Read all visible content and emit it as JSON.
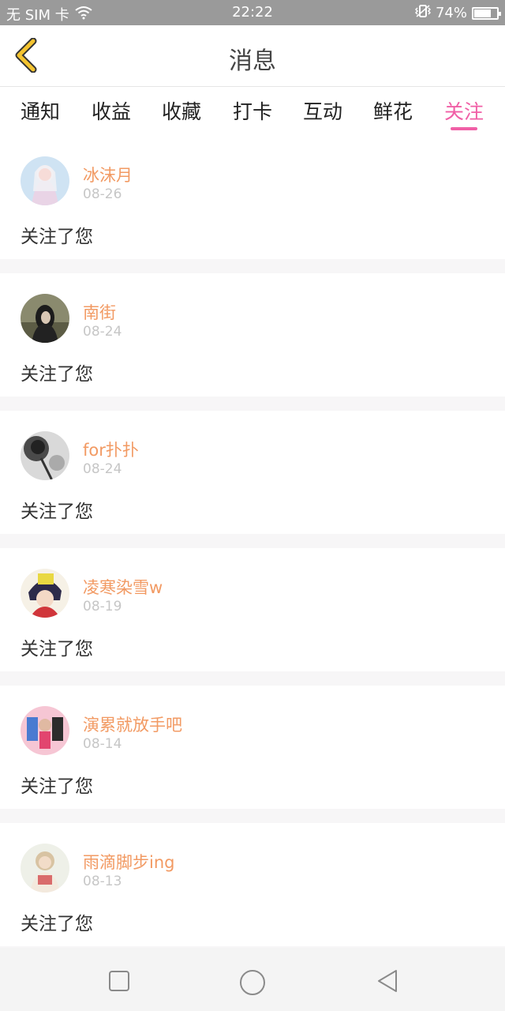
{
  "status_bar": {
    "carrier": "无 SIM 卡",
    "time": "22:22",
    "battery": "74%",
    "battery_level": 0.74
  },
  "header": {
    "title": "消息"
  },
  "tabs": [
    {
      "label": "通知",
      "active": false
    },
    {
      "label": "收益",
      "active": false
    },
    {
      "label": "收藏",
      "active": false
    },
    {
      "label": "打卡",
      "active": false
    },
    {
      "label": "互动",
      "active": false
    },
    {
      "label": "鲜花",
      "active": false
    },
    {
      "label": "关注",
      "active": true
    }
  ],
  "messages": [
    {
      "user": "冰沫月",
      "date": "08-26",
      "text": "关注了您"
    },
    {
      "user": "南街",
      "date": "08-24",
      "text": "关注了您"
    },
    {
      "user": "for扑扑",
      "date": "08-24",
      "text": "关注了您"
    },
    {
      "user": "凌寒染雪w",
      "date": "08-19",
      "text": "关注了您"
    },
    {
      "user": "演累就放手吧",
      "date": "08-14",
      "text": "关注了您"
    },
    {
      "user": "雨滴脚步ing",
      "date": "08-13",
      "text": "关注了您"
    }
  ],
  "icons": {
    "back": "chevron-left-icon",
    "wifi": "wifi-icon",
    "vibrate": "vibrate-icon",
    "recent": "square-icon",
    "home": "circle-icon",
    "nav_back": "triangle-back-icon"
  },
  "colors": {
    "accent": "#f05fa6",
    "username": "#f29a63",
    "back_icon": "#f4c430"
  }
}
